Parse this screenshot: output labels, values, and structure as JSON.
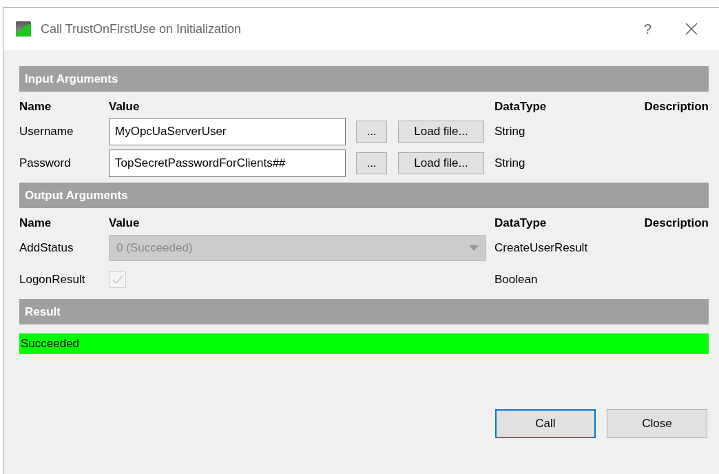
{
  "window": {
    "title": "Call TrustOnFirstUse on Initialization",
    "help": "?"
  },
  "input_arguments": {
    "header": "Input Arguments",
    "columns": [
      "Name",
      "Value",
      "DataType",
      "Description"
    ],
    "rows": [
      {
        "name": "Username",
        "value": "MyOpcUaServerUser",
        "browse": "...",
        "load": "Load file...",
        "datatype": "String"
      },
      {
        "name": "Password",
        "value": "TopSecretPasswordForClients##",
        "browse": "...",
        "load": "Load file...",
        "datatype": "String"
      }
    ]
  },
  "output_arguments": {
    "header": "Output Arguments",
    "columns": [
      "Name",
      "Value",
      "DataType",
      "Description"
    ],
    "rows": [
      {
        "kind": "combo",
        "name": "AddStatus",
        "value": "0 (Succeeded)",
        "disabled": true,
        "datatype": "CreateUserResult"
      },
      {
        "kind": "checkbox",
        "name": "LogonResult",
        "checked": true,
        "disabled": true,
        "datatype": "Boolean"
      }
    ]
  },
  "result": {
    "header": "Result",
    "text": "Succeeded",
    "success": true
  },
  "buttons": [
    {
      "label": "Call",
      "default": true
    },
    {
      "label": "Close",
      "default": false
    }
  ]
}
